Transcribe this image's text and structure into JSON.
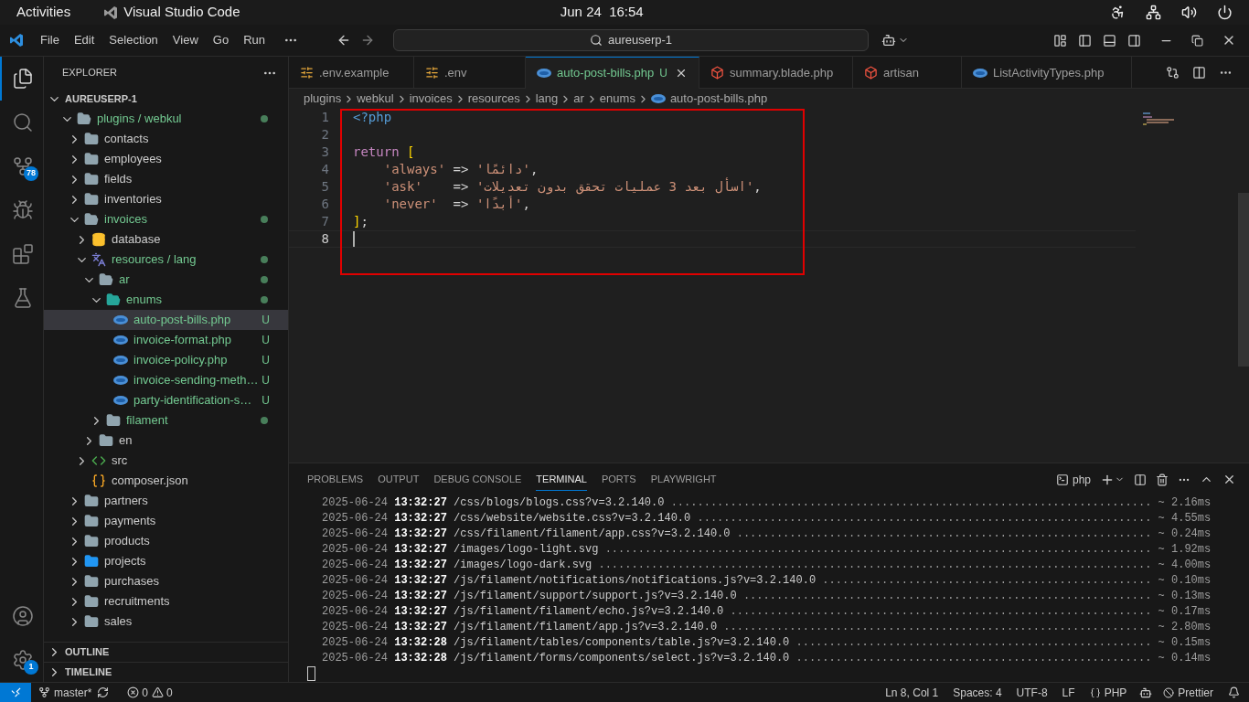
{
  "top_bar": {
    "activities": "Activities",
    "app_name": "Visual Studio Code",
    "clock": "Jun 24  16:54"
  },
  "title_bar": {
    "menu": [
      "File",
      "Edit",
      "Selection",
      "View",
      "Go",
      "Run"
    ],
    "search": "aureuserp-1"
  },
  "activity_bar": [
    {
      "kind": "explorer",
      "selected": true
    },
    {
      "kind": "search",
      "selected": false
    },
    {
      "kind": "source-control",
      "selected": false,
      "badge": "78"
    },
    {
      "kind": "run",
      "selected": false
    },
    {
      "kind": "extensions",
      "selected": false
    },
    {
      "kind": "testing",
      "selected": false
    }
  ],
  "activity_bottom": [
    {
      "kind": "account"
    },
    {
      "kind": "settings",
      "badge": "1"
    }
  ],
  "sidebar": {
    "title": "EXPLORER",
    "root": {
      "name": "AUREUSERP-1",
      "expanded": true,
      "children": [
        {
          "name": "plugins / webkul",
          "kind": "folder",
          "expanded": true,
          "selected": false,
          "modified": true,
          "children": [
            {
              "name": "contacts",
              "kind": "folder",
              "expanded": false,
              "selected": false,
              "modified": false
            },
            {
              "name": "employees",
              "kind": "folder",
              "expanded": false,
              "selected": false,
              "modified": false
            },
            {
              "name": "fields",
              "kind": "folder",
              "expanded": false,
              "selected": false,
              "modified": false
            },
            {
              "name": "inventories",
              "kind": "folder",
              "expanded": false,
              "selected": false,
              "modified": false
            },
            {
              "name": "invoices",
              "kind": "folder",
              "expanded": true,
              "selected": false,
              "modified": true,
              "children": [
                {
                  "name": "database",
                  "kind": "database",
                  "expanded": false,
                  "selected": false,
                  "modified": false
                },
                {
                  "name": "resources / lang",
                  "kind": "lang",
                  "expanded": true,
                  "selected": false,
                  "modified": true,
                  "children": [
                    {
                      "name": "ar",
                      "kind": "folder",
                      "expanded": true,
                      "selected": false,
                      "modified": true,
                      "children": [
                        {
                          "name": "enums",
                          "kind": "enums",
                          "expanded": true,
                          "selected": false,
                          "modified": true,
                          "children": [
                            {
                              "name": "auto-post-bills.php",
                              "kind": "php",
                              "selected": true,
                              "badge": "U"
                            },
                            {
                              "name": "invoice-format.php",
                              "kind": "php",
                              "selected": false,
                              "badge": "U"
                            },
                            {
                              "name": "invoice-policy.php",
                              "kind": "php",
                              "selected": false,
                              "badge": "U"
                            },
                            {
                              "name": "invoice-sending-meth…",
                              "kind": "php",
                              "selected": false,
                              "badge": "U"
                            },
                            {
                              "name": "party-identification-s…",
                              "kind": "php",
                              "selected": false,
                              "badge": "U"
                            }
                          ]
                        },
                        {
                          "name": "filament",
                          "kind": "folder",
                          "expanded": false,
                          "selected": false,
                          "modified": true
                        }
                      ]
                    },
                    {
                      "name": "en",
                      "kind": "folder",
                      "expanded": false,
                      "selected": false,
                      "modified": false
                    }
                  ]
                },
                {
                  "name": "src",
                  "kind": "src",
                  "expanded": false,
                  "selected": false,
                  "modified": false
                },
                {
                  "name": "composer.json",
                  "kind": "json",
                  "selected": false,
                  "modified": false
                }
              ]
            },
            {
              "name": "partners",
              "kind": "folder",
              "expanded": false,
              "selected": false,
              "modified": false
            },
            {
              "name": "payments",
              "kind": "folder",
              "expanded": false,
              "selected": false,
              "modified": false
            },
            {
              "name": "products",
              "kind": "folder",
              "expanded": false,
              "selected": false,
              "modified": false
            },
            {
              "name": "projects",
              "kind": "projects",
              "expanded": false,
              "selected": false,
              "modified": false
            },
            {
              "name": "purchases",
              "kind": "folder",
              "expanded": false,
              "selected": false,
              "modified": false
            },
            {
              "name": "recruitments",
              "kind": "folder",
              "expanded": false,
              "selected": false,
              "modified": false
            },
            {
              "name": "sales",
              "kind": "folder",
              "expanded": false,
              "selected": false,
              "modified": false
            }
          ]
        }
      ]
    },
    "sections": [
      {
        "title": "OUTLINE",
        "expanded": false
      },
      {
        "title": "TIMELINE",
        "expanded": false
      }
    ]
  },
  "tabs": [
    {
      "label": ".env.example",
      "kind": "env",
      "selected": false
    },
    {
      "label": ".env",
      "kind": "env",
      "selected": false
    },
    {
      "label": "auto-post-bills.php",
      "kind": "php",
      "selected": true,
      "badge": "U"
    },
    {
      "label": "summary.blade.php",
      "kind": "laravel",
      "selected": false
    },
    {
      "label": "artisan",
      "kind": "laravel",
      "selected": false
    },
    {
      "label": "ListActivityTypes.php",
      "kind": "php",
      "selected": false
    }
  ],
  "breadcrumbs": [
    "plugins",
    "webkul",
    "invoices",
    "resources",
    "lang",
    "ar",
    "enums",
    "auto-post-bills.php"
  ],
  "code": [
    {
      "number": "1",
      "tokens": [
        {
          "text": "<?php",
          "kind": "tag"
        }
      ]
    },
    {
      "number": "2"
    },
    {
      "number": "3",
      "tokens": [
        {
          "text": "return ",
          "kind": "keyword"
        },
        {
          "text": "[",
          "kind": "bracket"
        }
      ]
    },
    {
      "number": "4",
      "tokens": [
        {
          "text": "    'always'",
          "kind": "string"
        },
        {
          "text": " => ",
          "kind": "plain"
        },
        {
          "text": "'دائمًا'",
          "kind": "string"
        },
        {
          "text": ",",
          "kind": "plain"
        }
      ]
    },
    {
      "number": "5",
      "tokens": [
        {
          "text": "    'ask'",
          "kind": "string"
        },
        {
          "text": "    => ",
          "kind": "plain"
        },
        {
          "text": "'اسأل بعد 3 عمليات تحقق بدون تعديلات'",
          "kind": "string"
        },
        {
          "text": ",",
          "kind": "plain"
        }
      ]
    },
    {
      "number": "6",
      "tokens": [
        {
          "text": "    'never'",
          "kind": "string"
        },
        {
          "text": "  => ",
          "kind": "plain"
        },
        {
          "text": "'أبدًا'",
          "kind": "string"
        },
        {
          "text": ",",
          "kind": "plain"
        }
      ]
    },
    {
      "number": "7",
      "tokens": [
        {
          "text": "]",
          "kind": "bracket"
        },
        {
          "text": ";",
          "kind": "plain"
        }
      ]
    },
    {
      "number": "8",
      "current": true
    }
  ],
  "panel": {
    "tabs": [
      {
        "label": "PROBLEMS",
        "selected": false
      },
      {
        "label": "OUTPUT",
        "selected": false
      },
      {
        "label": "DEBUG CONSOLE",
        "selected": false
      },
      {
        "label": "TERMINAL",
        "selected": true
      },
      {
        "label": "PORTS",
        "selected": false
      },
      {
        "label": "PLAYWRIGHT",
        "selected": false
      }
    ],
    "terminal_name": "php",
    "lines": [
      {
        "date": "2025-06-24",
        "time": "13:32:27",
        "path": "/css/blogs/blogs.css?v=3.2.140.0",
        "dots": ".........................................................................",
        "duration": "~ 2.16ms"
      },
      {
        "date": "2025-06-24",
        "time": "13:32:27",
        "path": "/css/website/website.css?v=3.2.140.0",
        "dots": ".....................................................................",
        "duration": "~ 4.55ms"
      },
      {
        "date": "2025-06-24",
        "time": "13:32:27",
        "path": "/css/filament/filament/app.css?v=3.2.140.0",
        "dots": "...............................................................",
        "duration": "~ 0.24ms"
      },
      {
        "date": "2025-06-24",
        "time": "13:32:27",
        "path": "/images/logo-light.svg",
        "dots": "...................................................................................",
        "duration": "~ 1.92ms"
      },
      {
        "date": "2025-06-24",
        "time": "13:32:27",
        "path": "/images/logo-dark.svg",
        "dots": "....................................................................................",
        "duration": "~ 4.00ms"
      },
      {
        "date": "2025-06-24",
        "time": "13:32:27",
        "path": "/js/filament/notifications/notifications.js?v=3.2.140.0",
        "dots": "..................................................",
        "duration": "~ 0.10ms"
      },
      {
        "date": "2025-06-24",
        "time": "13:32:27",
        "path": "/js/filament/support/support.js?v=3.2.140.0",
        "dots": "..............................................................",
        "duration": "~ 0.13ms"
      },
      {
        "date": "2025-06-24",
        "time": "13:32:27",
        "path": "/js/filament/filament/echo.js?v=3.2.140.0",
        "dots": "................................................................",
        "duration": "~ 0.17ms"
      },
      {
        "date": "2025-06-24",
        "time": "13:32:27",
        "path": "/js/filament/filament/app.js?v=3.2.140.0",
        "dots": ".................................................................",
        "duration": "~ 2.80ms"
      },
      {
        "date": "2025-06-24",
        "time": "13:32:28",
        "path": "/js/filament/tables/components/table.js?v=3.2.140.0",
        "dots": "......................................................",
        "duration": "~ 0.15ms"
      },
      {
        "date": "2025-06-24",
        "time": "13:32:28",
        "path": "/js/filament/forms/components/select.js?v=3.2.140.0",
        "dots": "......................................................",
        "duration": "~ 0.14ms"
      }
    ]
  },
  "status_bar": {
    "branch": "master*",
    "errors": "0",
    "warnings": "0",
    "position": "Ln 8, Col 1",
    "spaces": "Spaces: 4",
    "encoding": "UTF-8",
    "eol": "LF",
    "language": "PHP",
    "formatter": "Prettier"
  }
}
